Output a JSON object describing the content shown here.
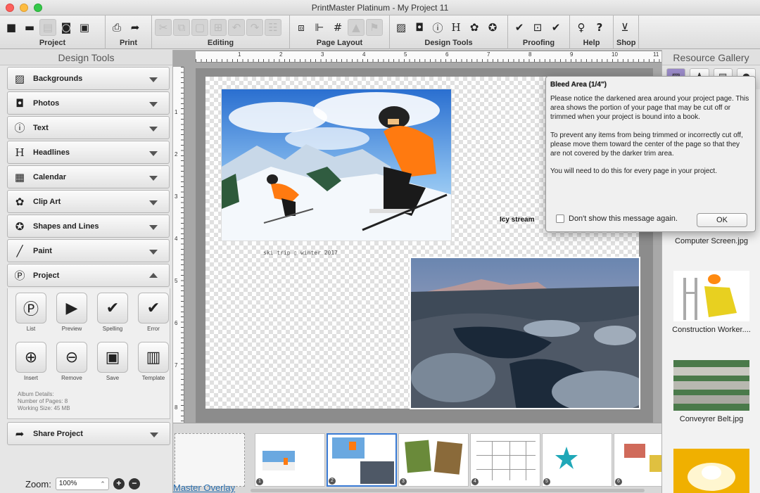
{
  "window": {
    "title": "PrintMaster Platinum - My Project 11"
  },
  "toolbar": {
    "groups": [
      {
        "label": "Project",
        "icons": [
          "new-page-icon",
          "open-folder-icon",
          "save-disk-icon",
          "camera-box-icon",
          "document-icon"
        ]
      },
      {
        "label": "Print",
        "icons": [
          "printer-icon",
          "share-arrow-icon"
        ]
      },
      {
        "label": "Editing",
        "icons": [
          "cut-icon",
          "copy-icon",
          "paste-icon",
          "duplicate-icon",
          "undo-icon",
          "redo-icon",
          "select-all-icon"
        ]
      },
      {
        "label": "Page Layout",
        "icons": [
          "layers-icon",
          "text-frame-icon",
          "grid-icon",
          "align-icon",
          "flag-icon"
        ]
      },
      {
        "label": "Design Tools",
        "icons": [
          "image-icon",
          "camera-icon",
          "text-tool-icon",
          "headline-icon",
          "clipart-icon",
          "shapes-icon"
        ]
      },
      {
        "label": "Proofing",
        "icons": [
          "spellcheck-icon",
          "preview-icon",
          "error-check-icon"
        ]
      },
      {
        "label": "Help",
        "icons": [
          "lightbulb-icon",
          "question-icon"
        ]
      },
      {
        "label": "Shop",
        "icons": [
          "cart-icon"
        ]
      }
    ]
  },
  "left_panel": {
    "title": "Design Tools",
    "sections": [
      {
        "label": "Backgrounds",
        "icon": "image-icon"
      },
      {
        "label": "Photos",
        "icon": "camera-icon"
      },
      {
        "label": "Text",
        "icon": "text-tool-icon"
      },
      {
        "label": "Headlines",
        "icon": "headline-icon"
      },
      {
        "label": "Calendar",
        "icon": "calendar-icon"
      },
      {
        "label": "Clip Art",
        "icon": "clipart-icon"
      },
      {
        "label": "Shapes and Lines",
        "icon": "shapes-icon"
      },
      {
        "label": "Paint",
        "icon": "paint-brush-icon"
      },
      {
        "label": "Project",
        "icon": "project-icon"
      }
    ],
    "project_buttons_row1": [
      {
        "label": "List",
        "icon": "list-p-icon"
      },
      {
        "label": "Preview",
        "icon": "preview-book-icon"
      },
      {
        "label": "Spelling",
        "icon": "spelling-check-icon"
      },
      {
        "label": "Error",
        "icon": "error-check-icon"
      }
    ],
    "project_buttons_row2": [
      {
        "label": "Insert",
        "icon": "insert-page-icon"
      },
      {
        "label": "Remove",
        "icon": "remove-page-icon"
      },
      {
        "label": "Save",
        "icon": "save-page-icon"
      },
      {
        "label": "Template",
        "icon": "template-icon"
      }
    ],
    "album": {
      "heading": "Album Details:",
      "pages_label": "Number of Pages:",
      "pages_value": "8",
      "size_label": "Working Size:",
      "size_value": "45 MB"
    },
    "share_label": "Share Project",
    "zoom": {
      "label": "Zoom:",
      "value": "100%"
    }
  },
  "canvas": {
    "ruler_top_numbers": [
      "1",
      "2",
      "3",
      "4",
      "5",
      "6",
      "7",
      "8",
      "9",
      "10",
      "11"
    ],
    "ruler_left_numbers": [
      "1",
      "2",
      "3",
      "4",
      "5",
      "6",
      "7",
      "8"
    ],
    "caption_photo1": "ski trip  ▯  winter 2017",
    "caption_photo2": "Icy stream"
  },
  "strip": {
    "master_label": "Master Overlay",
    "thumbs": [
      "1",
      "2",
      "3",
      "4",
      "5",
      "6"
    ]
  },
  "right_panel": {
    "title": "Resource Gallery",
    "items": [
      {
        "name": "Computer Screen.jpg"
      },
      {
        "name": "Construction Worker...."
      },
      {
        "name": "Conveyrer Belt.jpg"
      }
    ]
  },
  "popup": {
    "title": "Bleed Area (1/4\")",
    "para1": "Please notice the darkened area around your project page. This area shows the portion of your page that may be cut off or trimmed when your project is bound into a book.",
    "para2": "To prevent any items from being trimmed or incorrectly cut off, please move them toward the center of the page so that they are not covered by the darker trim area.",
    "para3": "You will need to do this for every page in your project.",
    "checkbox_label": "Don't show this message again.",
    "ok_label": "OK"
  }
}
